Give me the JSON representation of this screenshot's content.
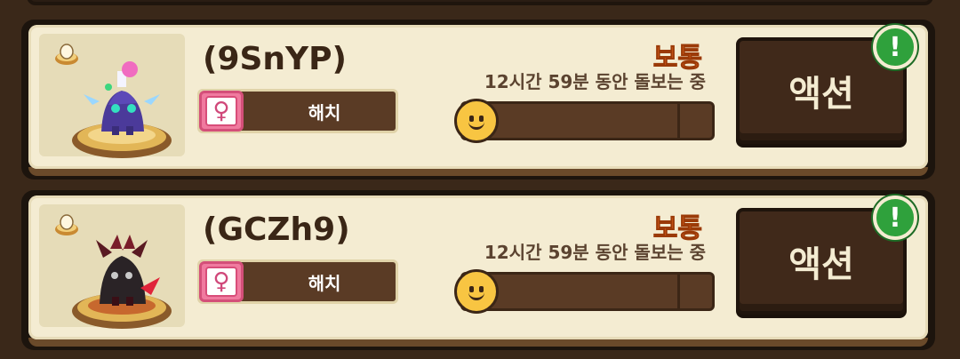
{
  "pets": [
    {
      "name": "(9SnYP)",
      "stage": "해치",
      "gender_symbol": "♀",
      "status": "보통",
      "duration": "12시간 59분 동안 돌보는 중",
      "progress": 0.05,
      "action_label": "액션",
      "alert_symbol": "!"
    },
    {
      "name": "(GCZh9)",
      "stage": "해치",
      "gender_symbol": "♀",
      "status": "보통",
      "duration": "12시간 59분 동안 돌보는 중",
      "progress": 0.05,
      "action_label": "액션",
      "alert_symbol": "!"
    }
  ],
  "colors": {
    "panel": "#f4ecd2",
    "status": "#ee6a25",
    "progress_fill": "#f28b2a",
    "badge": "#2fa13c"
  },
  "icons": {
    "egg": "egg-icon",
    "gender": "female-icon",
    "mood": "smiley-icon",
    "alert": "exclamation-icon"
  }
}
